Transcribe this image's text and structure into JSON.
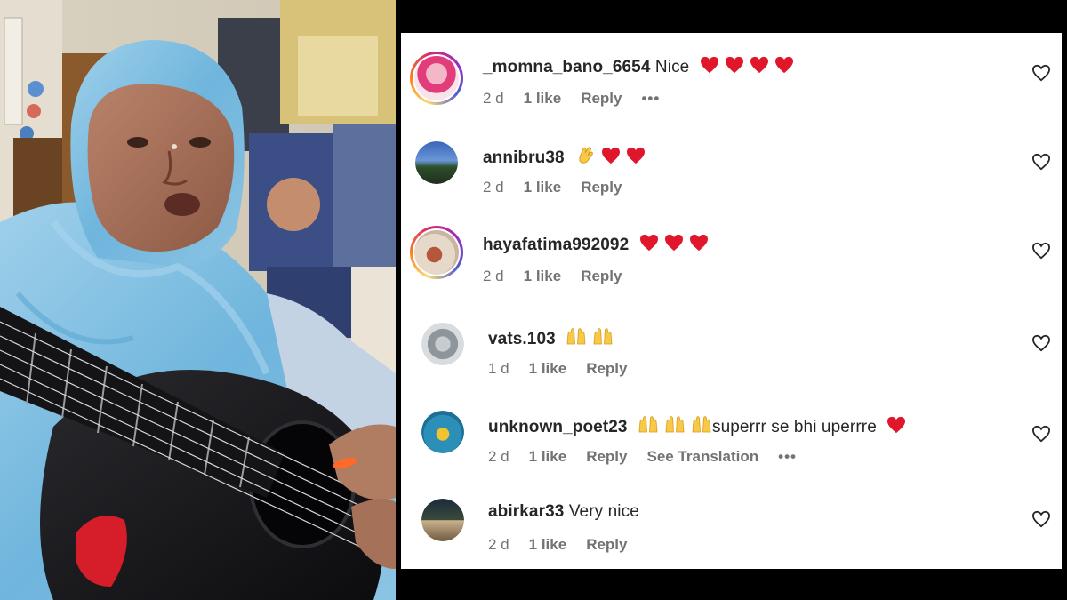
{
  "comments": [
    {
      "username": "_momna_bano_6654",
      "text": "Nice",
      "age": "2 d",
      "likes": "1 like",
      "reply": "Reply",
      "has_story": true,
      "emojis": [
        "red-heart",
        "red-heart",
        "red-heart",
        "red-heart"
      ],
      "has_more": true
    },
    {
      "username": "annibru38",
      "text": "",
      "age": "2 d",
      "likes": "1 like",
      "reply": "Reply",
      "has_story": false,
      "emojis": [
        "clapping-hands",
        "red-heart",
        "red-heart"
      ],
      "has_more": false
    },
    {
      "username": "hayafatima992092",
      "text": "",
      "age": "2 d",
      "likes": "1 like",
      "reply": "Reply",
      "has_story": true,
      "emojis": [
        "red-heart",
        "red-heart",
        "red-heart"
      ],
      "has_more": false
    },
    {
      "username": "vats.103",
      "text": "",
      "age": "1 d",
      "likes": "1 like",
      "reply": "Reply",
      "has_story": false,
      "emojis": [
        "raising-hands",
        "raising-hands"
      ],
      "has_more": false
    },
    {
      "username": "unknown_poet23",
      "text": "superrr se bhi uperrre",
      "age": "2 d",
      "likes": "1 like",
      "reply": "Reply",
      "translation": "See Translation",
      "has_story": false,
      "emojis_before": [
        "raising-hands",
        "raising-hands",
        "raising-hands"
      ],
      "emojis": [
        "red-heart"
      ],
      "has_more": true
    },
    {
      "username": "abirkar33",
      "text": "Very nice",
      "age": "2 d",
      "likes": "1 like",
      "reply": "Reply",
      "has_story": false,
      "emojis": [],
      "has_more": false
    }
  ],
  "icons": {
    "like": "heart-outline-icon",
    "more": "more-dots-icon"
  },
  "colors": {
    "heart": "#e0162b",
    "muted": "#737373",
    "text": "#262626"
  }
}
